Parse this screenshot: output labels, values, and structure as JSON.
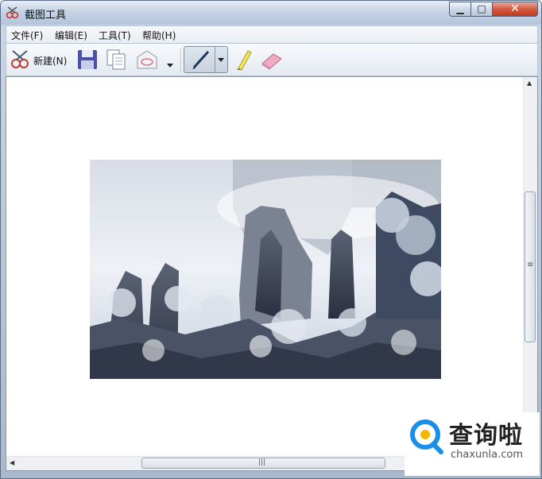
{
  "window": {
    "title": "截图工具",
    "controls": {
      "minimize": "▁",
      "maximize": "□",
      "close": "✕"
    }
  },
  "menu": [
    {
      "label": "文件(F)"
    },
    {
      "label": "编辑(E)"
    },
    {
      "label": "工具(T)"
    },
    {
      "label": "帮助(H)"
    }
  ],
  "toolbar": {
    "new_label": "新建(N)",
    "icons": [
      "snipping-scissors-icon",
      "save-icon",
      "copy-icon",
      "send-email-icon",
      "dropdown-arrow-icon",
      "pen-icon",
      "highlighter-icon",
      "eraser-icon"
    ]
  },
  "content": {
    "image_description": "snowy mountain peaks",
    "vscroll": {
      "up": "▲",
      "down": "▼",
      "grip": "≡"
    },
    "hscroll": {
      "left": "◀",
      "right": "▶",
      "grip": "|||"
    }
  },
  "watermark": {
    "main": "查询啦",
    "sub": "chaxunla.com",
    "color": "#1a8fe8"
  }
}
